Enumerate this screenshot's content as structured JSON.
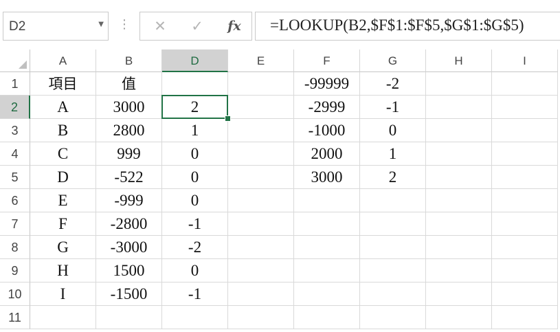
{
  "formula_bar": {
    "name_box": "D2",
    "name_box_dropdown_icon": "chevron-down-icon",
    "more_icon": "vertical-dots-icon",
    "cancel_icon": "✕",
    "enter_icon": "✓",
    "function_icon": "fx",
    "formula": "=LOOKUP(B2,$F$1:$F$5,$G$1:$G$5)"
  },
  "sheet": {
    "columns": [
      "A",
      "B",
      "D",
      "E",
      "F",
      "G",
      "H",
      "I"
    ],
    "selected_column": "D",
    "rows": [
      "1",
      "2",
      "3",
      "4",
      "5",
      "6",
      "7",
      "8",
      "9",
      "10",
      "11"
    ],
    "selected_row": "2",
    "active_cell": "D2",
    "cells": [
      [
        "項目",
        "值",
        "",
        "",
        "-99999",
        "-2",
        "",
        ""
      ],
      [
        "A",
        "3000",
        "2",
        "",
        "-2999",
        "-1",
        "",
        ""
      ],
      [
        "B",
        "2800",
        "1",
        "",
        "-1000",
        "0",
        "",
        ""
      ],
      [
        "C",
        "999",
        "0",
        "",
        "2000",
        "1",
        "",
        ""
      ],
      [
        "D",
        "-522",
        "0",
        "",
        "3000",
        "2",
        "",
        ""
      ],
      [
        "E",
        "-999",
        "0",
        "",
        "",
        "",
        "",
        ""
      ],
      [
        "F",
        "-2800",
        "-1",
        "",
        "",
        "",
        "",
        ""
      ],
      [
        "G",
        "-3000",
        "-2",
        "",
        "",
        "",
        "",
        ""
      ],
      [
        "H",
        "1500",
        "0",
        "",
        "",
        "",
        "",
        ""
      ],
      [
        "I",
        "-1500",
        "-1",
        "",
        "",
        "",
        "",
        ""
      ],
      [
        "",
        "",
        "",
        "",
        "",
        "",
        "",
        ""
      ]
    ]
  },
  "colors": {
    "accent": "#217346",
    "header_selected": "#d2d2d2",
    "gridline": "#d9d9d9"
  }
}
